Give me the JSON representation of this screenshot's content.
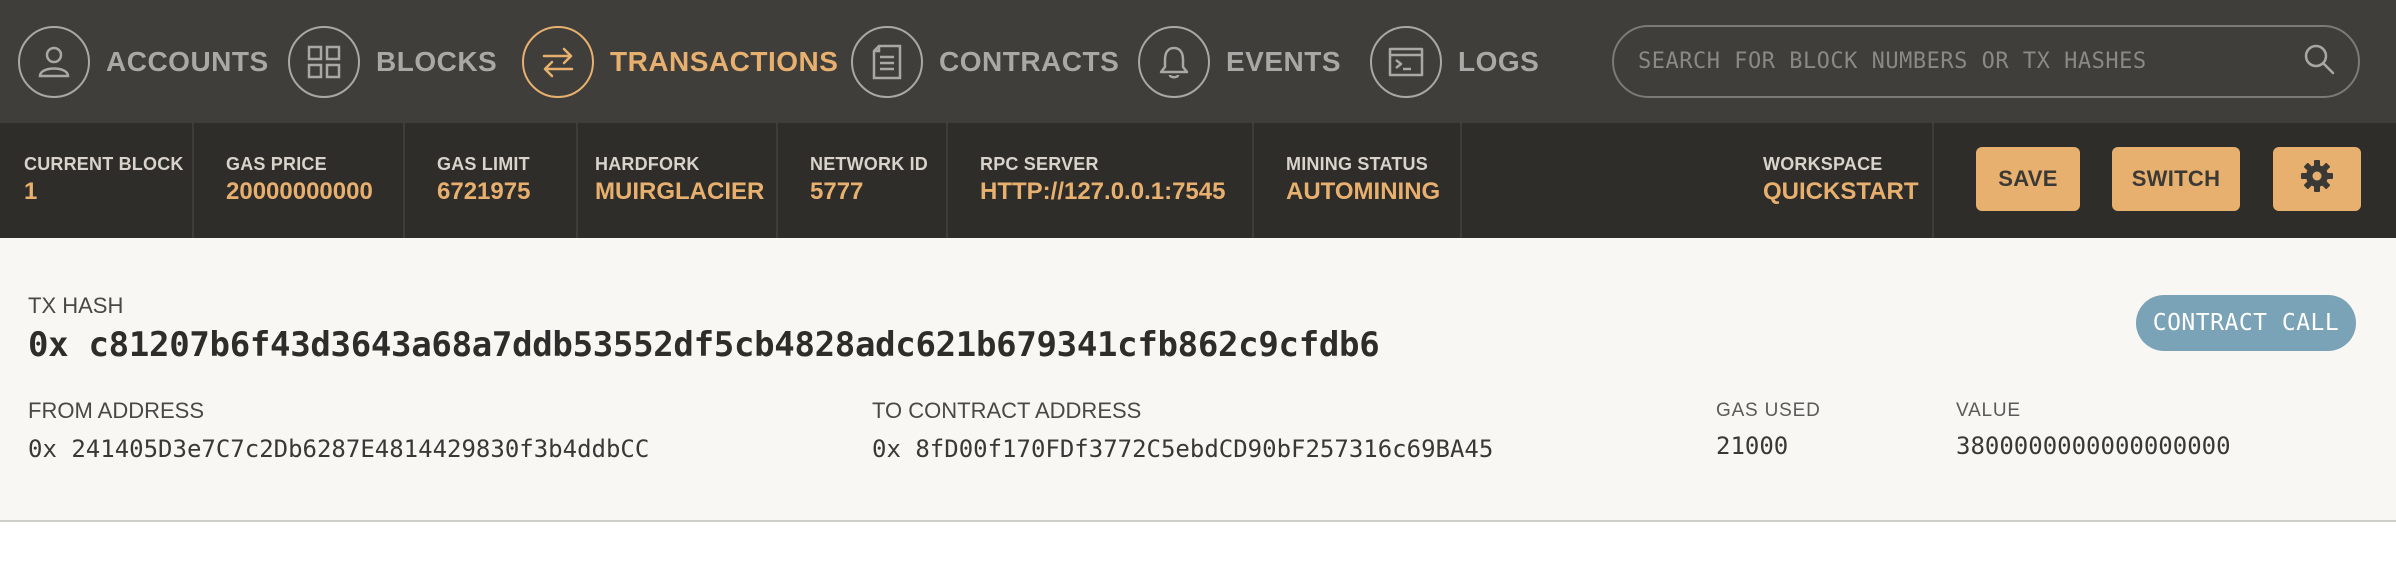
{
  "nav": {
    "items": [
      {
        "label": "ACCOUNTS",
        "icon": "user-icon",
        "active": false
      },
      {
        "label": "BLOCKS",
        "icon": "grid-icon",
        "active": false
      },
      {
        "label": "TRANSACTIONS",
        "icon": "swap-arrows-icon",
        "active": true
      },
      {
        "label": "CONTRACTS",
        "icon": "document-icon",
        "active": false
      },
      {
        "label": "EVENTS",
        "icon": "bell-icon",
        "active": false
      },
      {
        "label": "LOGS",
        "icon": "terminal-icon",
        "active": false
      }
    ],
    "search": {
      "placeholder": "SEARCH FOR BLOCK NUMBERS OR TX HASHES",
      "value": "",
      "icon": "search-icon"
    }
  },
  "status": {
    "current_block": {
      "label": "CURRENT BLOCK",
      "value": "1"
    },
    "gas_price": {
      "label": "GAS PRICE",
      "value": "20000000000"
    },
    "gas_limit": {
      "label": "GAS LIMIT",
      "value": "6721975"
    },
    "hardfork": {
      "label": "HARDFORK",
      "value": "MUIRGLACIER"
    },
    "network_id": {
      "label": "NETWORK ID",
      "value": "5777"
    },
    "rpc_server": {
      "label": "RPC SERVER",
      "value": "HTTP://127.0.0.1:7545"
    },
    "mining_status": {
      "label": "MINING STATUS",
      "value": "AUTOMINING"
    },
    "workspace": {
      "label": "WORKSPACE",
      "value": "QUICKSTART"
    },
    "save_label": "SAVE",
    "switch_label": "SWITCH",
    "settings_icon": "gear-icon"
  },
  "transaction": {
    "hash_label": "TX HASH",
    "hash": "0x c81207b6f43d3643a68a7ddb53552df5cb4828adc621b679341cfb862c9cfdb6",
    "type_badge": "CONTRACT CALL",
    "from_label": "FROM ADDRESS",
    "from": "0x 241405D3e7C7c2Db6287E4814429830f3b4ddbCC",
    "to_label": "TO CONTRACT ADDRESS",
    "to": "0x 8fD00f170FDf3772C5ebdCD90bF257316c69BA45",
    "gas_used_label": "GAS USED",
    "gas_used": "21000",
    "value_label": "VALUE",
    "value": "3800000000000000000"
  },
  "colors": {
    "nav_bg": "#3f3e3b",
    "status_bg": "#2f2d29",
    "accent": "#e8b06e",
    "inactive": "#a9a8a4",
    "badge": "#7aa3b7",
    "card_bg": "#f8f7f4"
  }
}
